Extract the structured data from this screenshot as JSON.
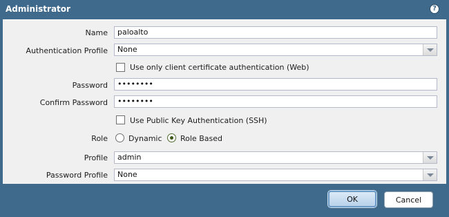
{
  "dialog": {
    "title": "Administrator",
    "help_icon": "?"
  },
  "form": {
    "name": {
      "label": "Name",
      "value": "paloalto"
    },
    "auth_profile": {
      "label": "Authentication Profile",
      "value": "None"
    },
    "client_cert": {
      "label": "Use only client certificate authentication (Web)",
      "checked": false
    },
    "password": {
      "label": "Password",
      "value": "••••••••"
    },
    "confirm_password": {
      "label": "Confirm Password",
      "value": "••••••••"
    },
    "public_key": {
      "label": "Use Public Key Authentication (SSH)",
      "checked": false
    },
    "role": {
      "label": "Role",
      "options": [
        "Dynamic",
        "Role Based"
      ],
      "selected": "Role Based"
    },
    "profile": {
      "label": "Profile",
      "value": "admin"
    },
    "password_profile": {
      "label": "Password Profile",
      "value": "None"
    }
  },
  "footer": {
    "ok_label": "OK",
    "cancel_label": "Cancel"
  },
  "colors": {
    "frame": "#3f6a8c",
    "body": "#f0f0f0",
    "field_border": "#b5b8c8",
    "radio_selected": "#3b5a17"
  },
  "icons": [
    "help-icon",
    "dropdown-arrow-icon"
  ]
}
